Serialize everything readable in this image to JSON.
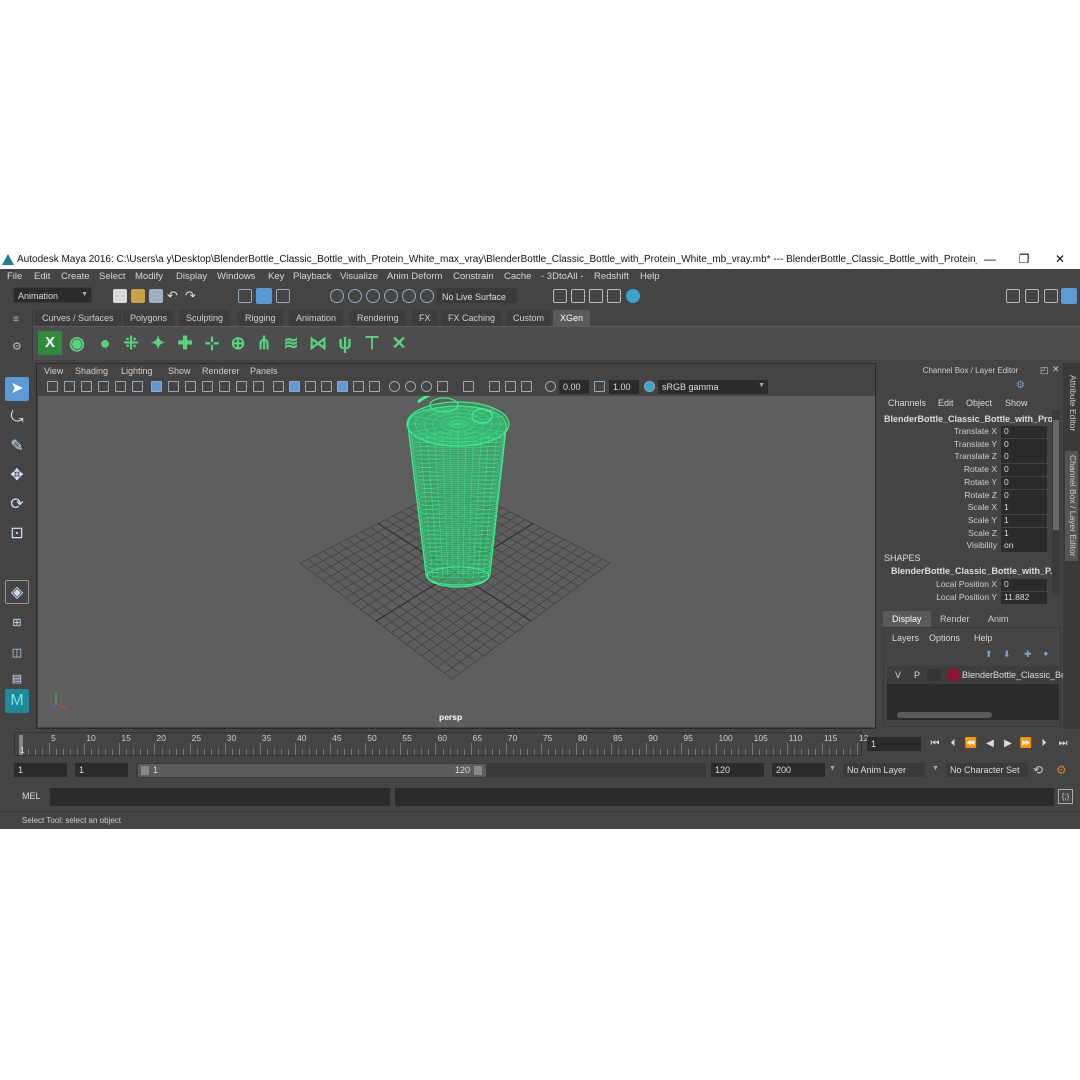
{
  "window": {
    "title": "Autodesk Maya 2016: C:\\Users\\a y\\Desktop\\BlenderBottle_Classic_Bottle_with_Protein_White_max_vray\\BlenderBottle_Classic_Bottle_with_Protein_White_mb_vray.mb*  ---  BlenderBottle_Classic_Bottle_with_Protein_White_ncl...",
    "minimize": "—",
    "restore": "❐",
    "close": "✕"
  },
  "menu": [
    "File",
    "Edit",
    "Create",
    "Select",
    "Modify",
    "Display",
    "Windows",
    "Key",
    "Playback",
    "Visualize",
    "Anim Deform",
    "Constrain",
    "Cache",
    "- 3DtoAll -",
    "Redshift",
    "Help"
  ],
  "statusline": {
    "mode": "Animation",
    "live_surface": "No Live Surface"
  },
  "shelf": {
    "tabs": [
      "Curves / Surfaces",
      "Polygons",
      "Sculpting",
      "Rigging",
      "Animation",
      "Rendering",
      "FX",
      "FX Caching",
      "Custom",
      "XGen"
    ],
    "active_tab": "XGen",
    "buttons": [
      "X",
      "◉",
      "●",
      "⁜",
      "✦",
      "✚",
      "⊹",
      "⊕",
      "⋔",
      "≋",
      "⋈",
      "ψ",
      "⊤",
      "✕"
    ]
  },
  "panel": {
    "menu": [
      "View",
      "Shading",
      "Lighting",
      "Show",
      "Renderer",
      "Panels"
    ],
    "exposure": "0.00",
    "gamma": "1.00",
    "color_space": "sRGB gamma",
    "camera_label": "persp"
  },
  "channel_box": {
    "header": "Channel Box / Layer Editor",
    "menu": [
      "Channels",
      "Edit",
      "Object",
      "Show"
    ],
    "object_name": "BlenderBottle_Classic_Bottle_with_Pro...",
    "attributes": [
      {
        "label": "Translate X",
        "value": "0"
      },
      {
        "label": "Translate Y",
        "value": "0"
      },
      {
        "label": "Translate Z",
        "value": "0"
      },
      {
        "label": "Rotate X",
        "value": "0"
      },
      {
        "label": "Rotate Y",
        "value": "0"
      },
      {
        "label": "Rotate Z",
        "value": "0"
      },
      {
        "label": "Scale X",
        "value": "1"
      },
      {
        "label": "Scale Y",
        "value": "1"
      },
      {
        "label": "Scale Z",
        "value": "1"
      },
      {
        "label": "Visibility",
        "value": "on"
      }
    ],
    "shapes_label": "SHAPES",
    "shape_name": "BlenderBottle_Classic_Bottle_with_P...",
    "shape_attributes": [
      {
        "label": "Local Position X",
        "value": "0"
      },
      {
        "label": "Local Position Y",
        "value": "11.882"
      }
    ]
  },
  "layer_editor": {
    "tabs": [
      "Display",
      "Render",
      "Anim"
    ],
    "active_tab": "Display",
    "menu": [
      "Layers",
      "Options",
      "Help"
    ],
    "layer": {
      "v": "V",
      "p": "P",
      "name": "BlenderBottle_Classic_Bo",
      "color": "#8b1530"
    }
  },
  "side_tabs": [
    "Attribute Editor",
    "Channel Box / Layer Editor"
  ],
  "timeline": {
    "ticks": [
      "1",
      "5",
      "10",
      "15",
      "20",
      "25",
      "30",
      "35",
      "40",
      "45",
      "50",
      "55",
      "60",
      "65",
      "70",
      "75",
      "80",
      "85",
      "90",
      "95",
      "100",
      "105",
      "110",
      "115",
      "12"
    ],
    "current_frame": "1"
  },
  "range": {
    "start": "1",
    "playback_start": "1",
    "slider_start": "1",
    "slider_end": "120",
    "playback_end": "120",
    "end": "200",
    "anim_layer": "No Anim Layer",
    "character_set": "No Character Set"
  },
  "command": {
    "lang": "MEL"
  },
  "help_line": "Select Tool: select an object",
  "colors": {
    "ui_bg": "#444444",
    "viewport_bg": "#5e5e5e",
    "wireframe": "#3cf08c",
    "selection": "#5a9bd6"
  }
}
